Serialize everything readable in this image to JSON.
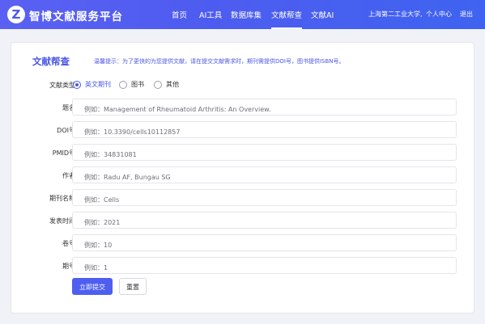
{
  "header": {
    "logo_letter": "Z",
    "brand": "智博文献服务平台",
    "nav": [
      {
        "label": "首页"
      },
      {
        "label": "AI工具"
      },
      {
        "label": "数据库集"
      },
      {
        "label": "文献帮查",
        "active": true
      },
      {
        "label": "文献AI"
      }
    ],
    "school": "上海第二工业大学,",
    "user_center": "个人中心",
    "logout": "退出"
  },
  "form": {
    "title": "文献帮查",
    "hint": "温馨提示：为了更快的为您提供文献，请在提交文献需求时，期刊需提供DOI号，图书提供ISBN号。",
    "type_label": "文献类型",
    "type_options": [
      "英文期刊",
      "图书",
      "其他"
    ],
    "selected_type": "英文期刊",
    "fields": [
      {
        "label": "题名",
        "placeholder": "例如：Management of Rheumatoid Arthritis: An Overview."
      },
      {
        "label": "DOI号",
        "placeholder": "例如：10.3390/cells10112857"
      },
      {
        "label": "PMID号",
        "placeholder": "例如：34831081"
      },
      {
        "label": "作者",
        "placeholder": "例如：Radu AF, Bungau SG"
      },
      {
        "label": "期刊名称",
        "placeholder": "例如：Cells"
      },
      {
        "label": "发表时间",
        "placeholder": "例如：2021"
      },
      {
        "label": "卷号",
        "placeholder": "例如：10"
      },
      {
        "label": "期号",
        "placeholder": "例如：1"
      }
    ],
    "submit_label": "立即提交",
    "reset_label": "重置"
  },
  "colors": {
    "accent": "#4a57e6",
    "header_start": "#5a61f2",
    "header_end": "#3f63f0",
    "page_bg": "#f0f2f7"
  }
}
